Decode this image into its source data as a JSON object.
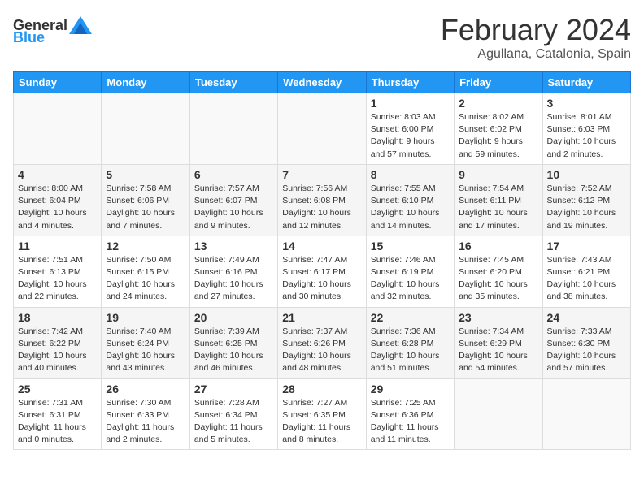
{
  "header": {
    "logo_general": "General",
    "logo_blue": "Blue",
    "month_title": "February 2024",
    "location": "Agullana, Catalonia, Spain"
  },
  "days_of_week": [
    "Sunday",
    "Monday",
    "Tuesday",
    "Wednesday",
    "Thursday",
    "Friday",
    "Saturday"
  ],
  "weeks": [
    [
      {
        "num": "",
        "info": ""
      },
      {
        "num": "",
        "info": ""
      },
      {
        "num": "",
        "info": ""
      },
      {
        "num": "",
        "info": ""
      },
      {
        "num": "1",
        "info": "Sunrise: 8:03 AM\nSunset: 6:00 PM\nDaylight: 9 hours and 57 minutes."
      },
      {
        "num": "2",
        "info": "Sunrise: 8:02 AM\nSunset: 6:02 PM\nDaylight: 9 hours and 59 minutes."
      },
      {
        "num": "3",
        "info": "Sunrise: 8:01 AM\nSunset: 6:03 PM\nDaylight: 10 hours and 2 minutes."
      }
    ],
    [
      {
        "num": "4",
        "info": "Sunrise: 8:00 AM\nSunset: 6:04 PM\nDaylight: 10 hours and 4 minutes."
      },
      {
        "num": "5",
        "info": "Sunrise: 7:58 AM\nSunset: 6:06 PM\nDaylight: 10 hours and 7 minutes."
      },
      {
        "num": "6",
        "info": "Sunrise: 7:57 AM\nSunset: 6:07 PM\nDaylight: 10 hours and 9 minutes."
      },
      {
        "num": "7",
        "info": "Sunrise: 7:56 AM\nSunset: 6:08 PM\nDaylight: 10 hours and 12 minutes."
      },
      {
        "num": "8",
        "info": "Sunrise: 7:55 AM\nSunset: 6:10 PM\nDaylight: 10 hours and 14 minutes."
      },
      {
        "num": "9",
        "info": "Sunrise: 7:54 AM\nSunset: 6:11 PM\nDaylight: 10 hours and 17 minutes."
      },
      {
        "num": "10",
        "info": "Sunrise: 7:52 AM\nSunset: 6:12 PM\nDaylight: 10 hours and 19 minutes."
      }
    ],
    [
      {
        "num": "11",
        "info": "Sunrise: 7:51 AM\nSunset: 6:13 PM\nDaylight: 10 hours and 22 minutes."
      },
      {
        "num": "12",
        "info": "Sunrise: 7:50 AM\nSunset: 6:15 PM\nDaylight: 10 hours and 24 minutes."
      },
      {
        "num": "13",
        "info": "Sunrise: 7:49 AM\nSunset: 6:16 PM\nDaylight: 10 hours and 27 minutes."
      },
      {
        "num": "14",
        "info": "Sunrise: 7:47 AM\nSunset: 6:17 PM\nDaylight: 10 hours and 30 minutes."
      },
      {
        "num": "15",
        "info": "Sunrise: 7:46 AM\nSunset: 6:19 PM\nDaylight: 10 hours and 32 minutes."
      },
      {
        "num": "16",
        "info": "Sunrise: 7:45 AM\nSunset: 6:20 PM\nDaylight: 10 hours and 35 minutes."
      },
      {
        "num": "17",
        "info": "Sunrise: 7:43 AM\nSunset: 6:21 PM\nDaylight: 10 hours and 38 minutes."
      }
    ],
    [
      {
        "num": "18",
        "info": "Sunrise: 7:42 AM\nSunset: 6:22 PM\nDaylight: 10 hours and 40 minutes."
      },
      {
        "num": "19",
        "info": "Sunrise: 7:40 AM\nSunset: 6:24 PM\nDaylight: 10 hours and 43 minutes."
      },
      {
        "num": "20",
        "info": "Sunrise: 7:39 AM\nSunset: 6:25 PM\nDaylight: 10 hours and 46 minutes."
      },
      {
        "num": "21",
        "info": "Sunrise: 7:37 AM\nSunset: 6:26 PM\nDaylight: 10 hours and 48 minutes."
      },
      {
        "num": "22",
        "info": "Sunrise: 7:36 AM\nSunset: 6:28 PM\nDaylight: 10 hours and 51 minutes."
      },
      {
        "num": "23",
        "info": "Sunrise: 7:34 AM\nSunset: 6:29 PM\nDaylight: 10 hours and 54 minutes."
      },
      {
        "num": "24",
        "info": "Sunrise: 7:33 AM\nSunset: 6:30 PM\nDaylight: 10 hours and 57 minutes."
      }
    ],
    [
      {
        "num": "25",
        "info": "Sunrise: 7:31 AM\nSunset: 6:31 PM\nDaylight: 11 hours and 0 minutes."
      },
      {
        "num": "26",
        "info": "Sunrise: 7:30 AM\nSunset: 6:33 PM\nDaylight: 11 hours and 2 minutes."
      },
      {
        "num": "27",
        "info": "Sunrise: 7:28 AM\nSunset: 6:34 PM\nDaylight: 11 hours and 5 minutes."
      },
      {
        "num": "28",
        "info": "Sunrise: 7:27 AM\nSunset: 6:35 PM\nDaylight: 11 hours and 8 minutes."
      },
      {
        "num": "29",
        "info": "Sunrise: 7:25 AM\nSunset: 6:36 PM\nDaylight: 11 hours and 11 minutes."
      },
      {
        "num": "",
        "info": ""
      },
      {
        "num": "",
        "info": ""
      }
    ]
  ]
}
